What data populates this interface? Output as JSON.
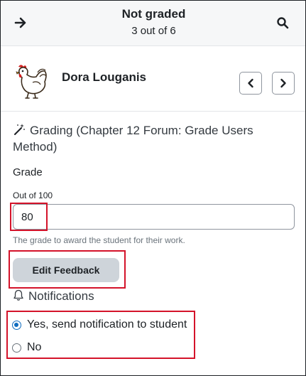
{
  "header": {
    "title": "Not graded",
    "subtitle": "3 out of 6",
    "back_icon": "arrow-right-icon",
    "search_icon": "search-icon"
  },
  "user": {
    "name": "Dora Louganis",
    "avatar_icon": "rooster-avatar"
  },
  "grading": {
    "heading": "Grading (Chapter 12 Forum: Grade Users Method)",
    "grade_label": "Grade",
    "out_of": "Out of 100",
    "grade_value": "80",
    "hint": "The grade to award the student for their work.",
    "edit_feedback": "Edit Feedback"
  },
  "notifications": {
    "heading": "Notifications",
    "options": [
      {
        "label": "Yes, send notification to student",
        "selected": true
      },
      {
        "label": "No",
        "selected": false
      }
    ]
  },
  "colors": {
    "accent": "#0f6cbf",
    "highlight": "#d4132a",
    "header_bg": "#f6f7f8",
    "button_bg": "#ced4da"
  }
}
